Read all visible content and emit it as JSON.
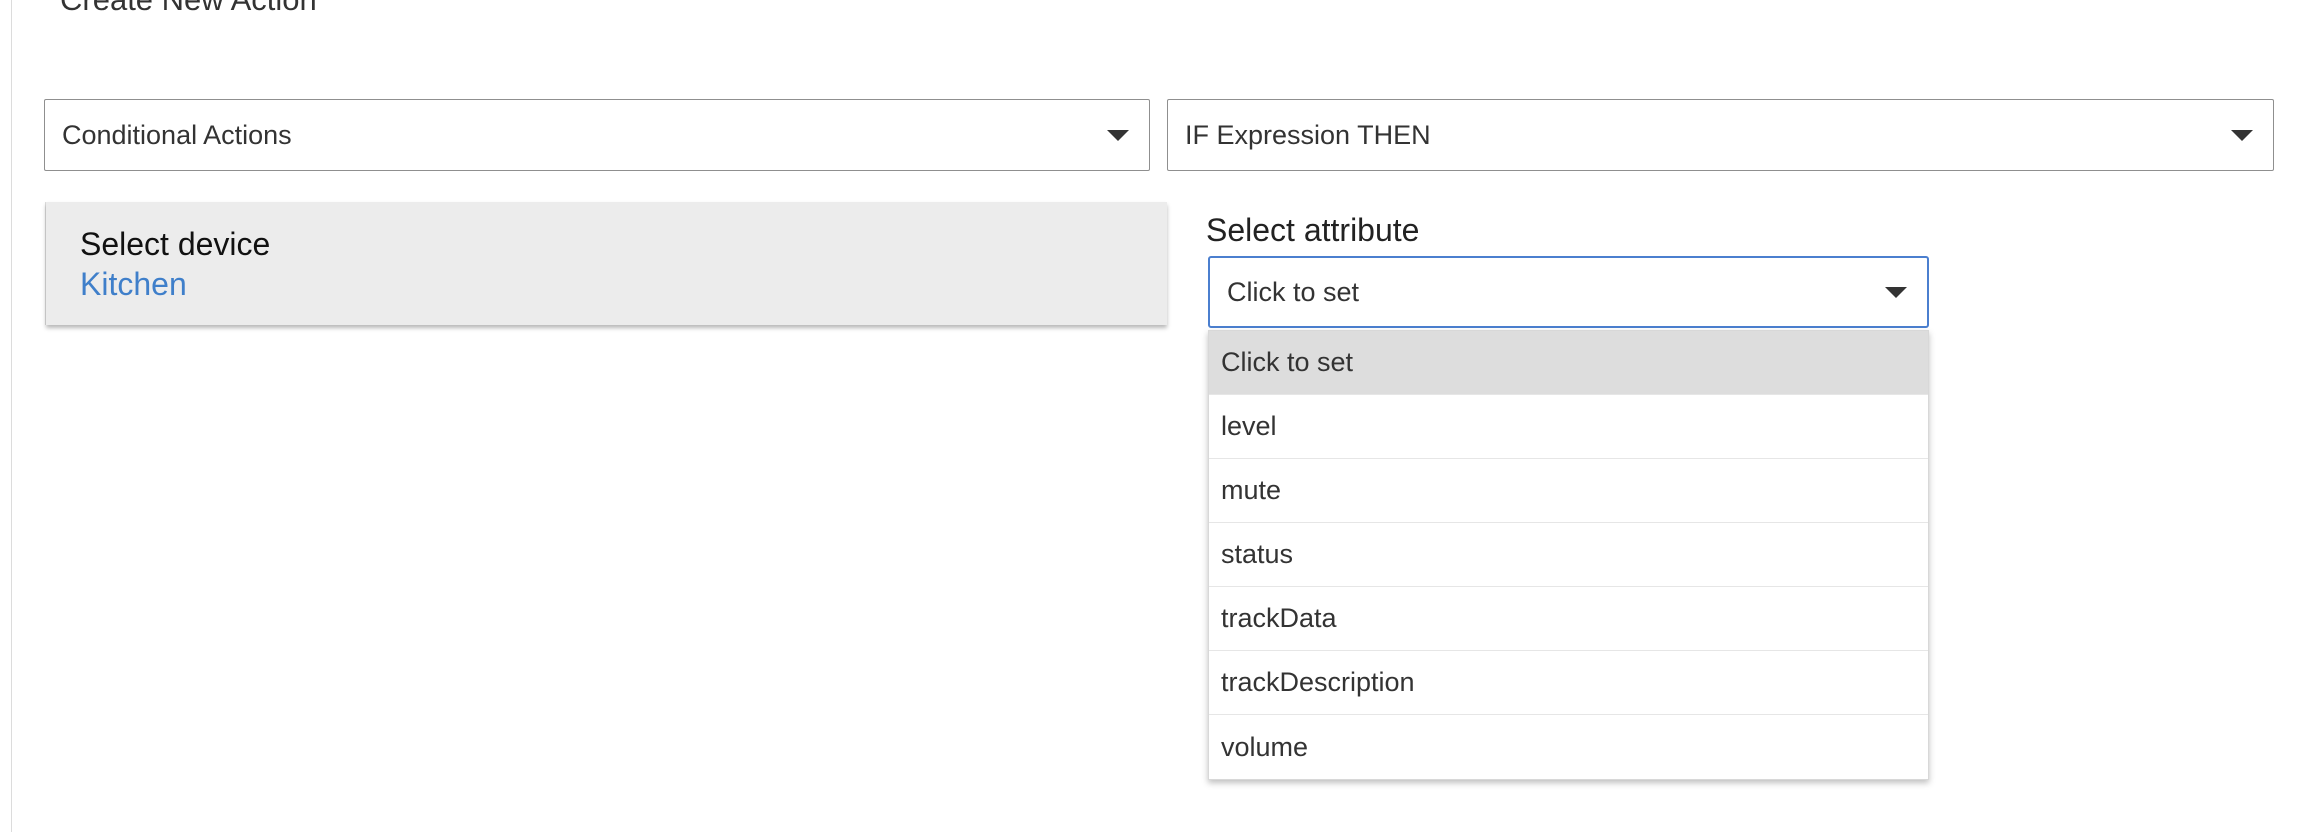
{
  "page": {
    "section_title": "Create New Action"
  },
  "selects": {
    "action_type": "Conditional Actions",
    "action": "IF Expression THEN"
  },
  "device": {
    "label": "Select device",
    "value": "Kitchen"
  },
  "attribute": {
    "label": "Select attribute",
    "value": "Click to set",
    "options": [
      "Click to set",
      "level",
      "mute",
      "status",
      "trackData",
      "trackDescription",
      "volume"
    ],
    "selected_index": 0
  },
  "colors": {
    "link": "#3f7fca",
    "focus_border": "#4b7fcf",
    "card_bg": "#ececec",
    "option_highlight": "#dddddd"
  },
  "icons": {
    "dropdown": "caret-down-icon"
  }
}
